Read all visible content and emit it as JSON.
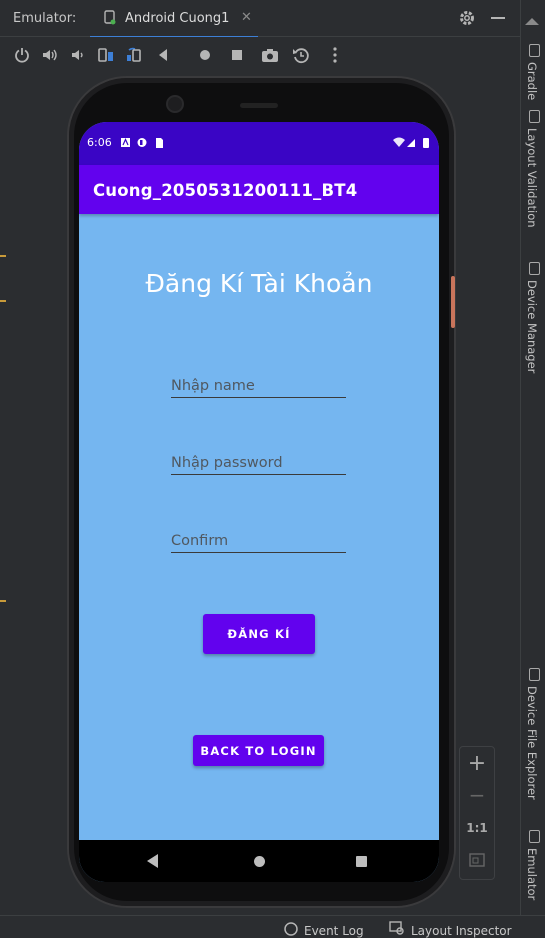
{
  "ide": {
    "emulator_label": "Emulator:",
    "tab_title": "Android Cuong1",
    "tab_close": "✕",
    "right_tools": [
      "Gradle",
      "Layout Validation",
      "Device Manager",
      "Device File Explorer",
      "Emulator"
    ],
    "bottom_tools": [
      "Event Log",
      "Layout Inspector"
    ],
    "zoom": {
      "in": "+",
      "out": "−",
      "one_to_one": "1:1"
    }
  },
  "device": {
    "status_time": "6:06",
    "app_title": "Cuong_2050531200111_BT4",
    "heading": "Đăng Kí Tài Khoản",
    "name_placeholder": "Nhập name",
    "password_placeholder": "Nhập password",
    "confirm_placeholder": "Confirm",
    "register_button": "ĐĂNG KÍ",
    "back_button": "BACK TO LOGIN"
  },
  "colors": {
    "status_bar": "#3a05c5",
    "app_bar": "#6202ee",
    "screen_bg": "#75b6f0",
    "button": "#6202ee"
  }
}
